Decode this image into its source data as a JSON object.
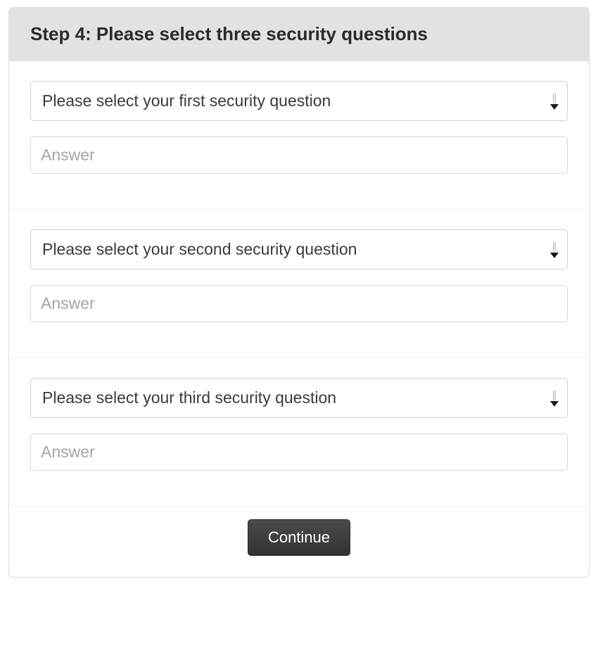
{
  "header": {
    "title": "Step 4: Please select three security questions"
  },
  "questions": [
    {
      "select_text": "Please select your first security question",
      "answer_placeholder": "Answer"
    },
    {
      "select_text": "Please select your second security question",
      "answer_placeholder": "Answer"
    },
    {
      "select_text": "Please select your third security question",
      "answer_placeholder": "Answer"
    }
  ],
  "actions": {
    "continue_label": "Continue"
  }
}
